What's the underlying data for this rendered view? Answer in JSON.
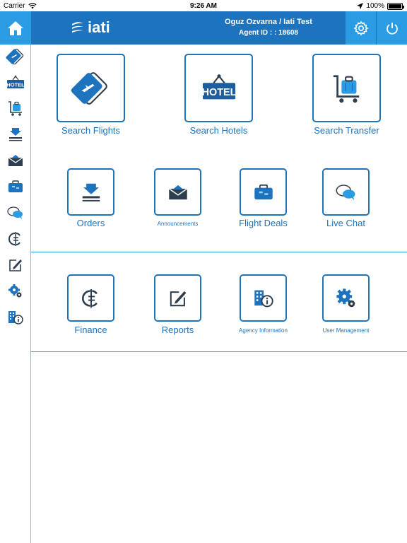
{
  "status_bar": {
    "carrier": "Carrier",
    "time": "9:26 AM",
    "battery": "100%"
  },
  "header": {
    "logo_text": "iati",
    "user_name": "Oguz Ozvarna / Iati Test",
    "agent_id": "Agent ID : : 18608"
  },
  "sidebar": {
    "items": [
      {
        "icon": "flight-tickets-icon"
      },
      {
        "icon": "hotel-sign-icon",
        "text": "HOTEL"
      },
      {
        "icon": "luggage-cart-icon"
      },
      {
        "icon": "download-tray-icon"
      },
      {
        "icon": "envelope-icon"
      },
      {
        "icon": "briefcase-icon"
      },
      {
        "icon": "chat-bubbles-icon"
      },
      {
        "icon": "finance-icon"
      },
      {
        "icon": "edit-note-icon"
      },
      {
        "icon": "gears-icon"
      },
      {
        "icon": "building-info-icon"
      }
    ]
  },
  "main": {
    "top_row": [
      {
        "label": "Search Flights"
      },
      {
        "label": "Search Hotels",
        "sign_text": "HOTEL"
      },
      {
        "label": "Search Transfer"
      }
    ],
    "middle_row": [
      {
        "label": "Orders"
      },
      {
        "label": "Announcements"
      },
      {
        "label": "Flight Deals"
      },
      {
        "label": "Live Chat"
      }
    ],
    "bottom_row": [
      {
        "label": "Finance"
      },
      {
        "label": "Reports"
      },
      {
        "label": "Agency Information"
      },
      {
        "label": "User Management"
      }
    ]
  },
  "colors": {
    "brand_blue": "#1e73be",
    "light_blue": "#2a9ce3",
    "icon_dark": "#2f3e4e"
  }
}
